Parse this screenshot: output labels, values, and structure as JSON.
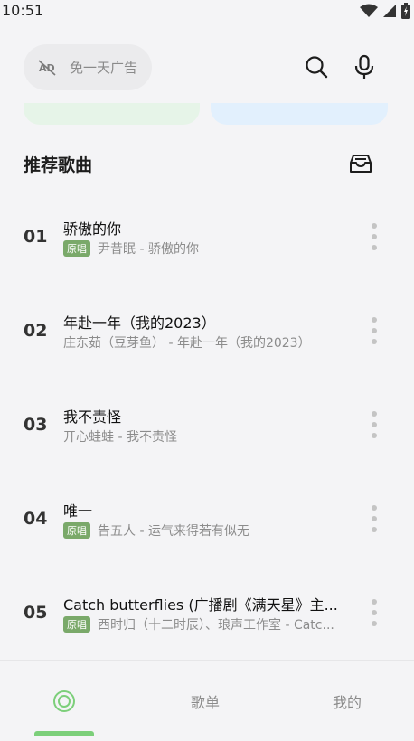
{
  "status_bar": {
    "time": "10:51",
    "icons": [
      "wifi-icon",
      "signal-icon",
      "battery-icon"
    ]
  },
  "top": {
    "ad_label": "免一天广告",
    "ad_icon": "no-ads-icon",
    "search_icon": "search-icon",
    "mic_icon": "microphone-icon"
  },
  "colors": {
    "accent": "#7ccf7a",
    "badge": "#7aa96a",
    "banner_green": "#e6f4e8",
    "banner_blue": "#e2f0fd",
    "background": "#f4f4f6"
  },
  "section": {
    "title": "推荐歌曲",
    "action_icon": "inbox-tray-icon"
  },
  "songs": [
    {
      "num": "01",
      "title": "骄傲的你",
      "badge": "原唱",
      "artist": "尹昔眠 - 骄傲的你"
    },
    {
      "num": "02",
      "title": "年赴一年（我的2023）",
      "badge": "",
      "artist": "庄东茹（豆芽鱼） - 年赴一年（我的2023）"
    },
    {
      "num": "03",
      "title": "我不责怪",
      "badge": "",
      "artist": "开心蛙蛙 - 我不责怪"
    },
    {
      "num": "04",
      "title": "唯一",
      "badge": "原唱",
      "artist": "告五人 - 运气来得若有似无"
    },
    {
      "num": "05",
      "title": "Catch butterflies (广播剧《满天星》主...",
      "badge": "原唱",
      "artist": "西时归（十二时辰）、琅声工作室 - Catc..."
    }
  ],
  "bottom_nav": {
    "home_icon": "target-circle-icon",
    "playlist": "歌单",
    "mine": "我的"
  }
}
